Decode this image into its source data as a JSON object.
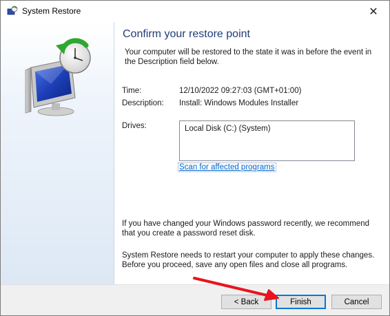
{
  "window": {
    "title": "System Restore",
    "close_glyph": "✕"
  },
  "main": {
    "heading": "Confirm your restore point",
    "intro": "Your computer will be restored to the state it was in before the event in the Description field below.",
    "time_label": "Time:",
    "time_value": "12/10/2022 09:27:03 (GMT+01:00)",
    "description_label": "Description:",
    "description_value": "Install: Windows Modules Installer",
    "drives_label": "Drives:",
    "drives": [
      "Local Disk (C:) (System)"
    ],
    "scan_link": "Scan for affected programs",
    "password_note": "If you have changed your Windows password recently, we recommend that you create a password reset disk.",
    "restart_note": "System Restore needs to restart your computer to apply these changes. Before you proceed, save any open files and close all programs."
  },
  "footer": {
    "back_label": "< Back",
    "finish_label": "Finish",
    "cancel_label": "Cancel"
  },
  "annotation": {
    "arrow_color": "#e8141e"
  },
  "icons": [
    "system-restore-icon",
    "close-icon",
    "restore-monitor-clock-icon"
  ]
}
